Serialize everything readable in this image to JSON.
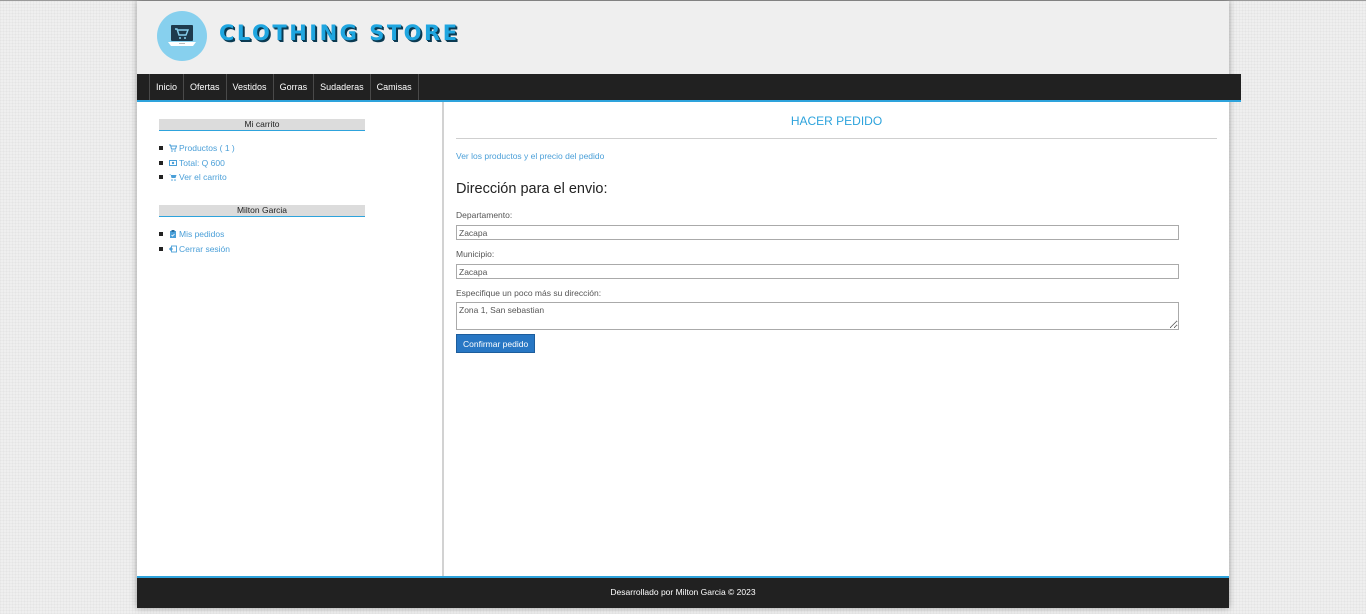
{
  "header": {
    "brand": "CLOTHING STORE",
    "logo_icon": "laptop-cart-icon"
  },
  "nav": {
    "items": [
      {
        "label": "Inicio"
      },
      {
        "label": "Ofertas"
      },
      {
        "label": "Vestidos"
      },
      {
        "label": "Gorras"
      },
      {
        "label": "Sudaderas"
      },
      {
        "label": "Camisas"
      }
    ]
  },
  "sidebar": {
    "cart": {
      "title": "Mi carrito",
      "items": [
        {
          "label": "Productos ( 1 )",
          "icon": "cart-icon"
        },
        {
          "label": "Total: Q 600",
          "icon": "money-icon"
        },
        {
          "label": "Ver el carrito",
          "icon": "cart-icon"
        }
      ]
    },
    "user": {
      "title": "Milton Garcia",
      "items": [
        {
          "label": "Mis pedidos",
          "icon": "clipboard-icon"
        },
        {
          "label": "Cerrar sesión",
          "icon": "logout-icon"
        }
      ]
    }
  },
  "main": {
    "title": "HACER PEDIDO",
    "order_link": "Ver los productos y el precio del pedido",
    "section_title": "Dirección para el envio:",
    "form": {
      "department_label": "Departamento:",
      "department_value": "Zacapa",
      "municipality_label": "Municipio:",
      "municipality_value": "Zacapa",
      "address_label": "Especifique un poco más su dirección:",
      "address_value": "Zona 1, San sebastian",
      "submit_label": "Confirmar pedido"
    }
  },
  "footer": {
    "text": "Desarrollado por Milton Garcia © 2023"
  },
  "colors": {
    "accent": "#2ea3dc",
    "dark": "#212121",
    "button": "#2877c4",
    "link": "#4a9fd8"
  }
}
